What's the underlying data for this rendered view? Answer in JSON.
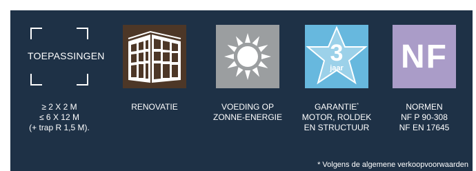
{
  "features": [
    {
      "icon": "bracket-frame",
      "icon_label": "TOEPASSINGEN",
      "caption": [
        "≥ 2 X 2 M",
        "≤ 6 X 12 M",
        "(+ trap R 1,5 M)."
      ]
    },
    {
      "icon": "building-facade-icon",
      "caption": [
        "RENOVATIE"
      ]
    },
    {
      "icon": "sun-icon",
      "caption": [
        "VOEDING OP",
        "ZONNE-ENERGIE"
      ]
    },
    {
      "icon": "star-badge-icon",
      "badge_number": "3",
      "badge_unit": "jaar",
      "caption_first": "GARANTIE",
      "caption_mark": "*",
      "caption": [
        "MOTOR, ROLDEK",
        "EN STRUCTUUR"
      ]
    },
    {
      "icon": "nf-logo",
      "logo_text": "NF",
      "caption": [
        "NORMEN",
        "NF P 90-308",
        "NF EN 17645"
      ]
    }
  ],
  "footnote": "* Volgens de algemene verkoopvoorwaarden",
  "colors": {
    "panel": "#1e3146",
    "renovatie": "#4d3727",
    "zonne": "#9b9ea0",
    "garantie": "#67b8de",
    "normen": "#aa9cc8"
  }
}
